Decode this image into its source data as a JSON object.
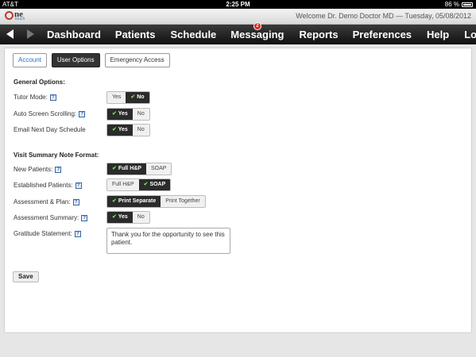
{
  "status_bar": {
    "carrier": "AT&T",
    "time": "2:25 PM",
    "battery": "86 %"
  },
  "header": {
    "logo_main": "ne",
    "logo_sub": "touch",
    "welcome": "Welcome Dr. Demo Doctor MD — Tuesday, 05/08/2012"
  },
  "nav": {
    "items": [
      {
        "label": "Dashboard"
      },
      {
        "label": "Patients"
      },
      {
        "label": "Schedule"
      },
      {
        "label": "Messaging",
        "badge": "2"
      },
      {
        "label": "Reports"
      },
      {
        "label": "Preferences"
      },
      {
        "label": "Help"
      },
      {
        "label": "Logout"
      }
    ]
  },
  "tabs": [
    {
      "label": "Account"
    },
    {
      "label": "User Options"
    },
    {
      "label": "Emergency Access"
    }
  ],
  "general": {
    "title": "General Options:",
    "tutor": {
      "label": "Tutor Mode:",
      "options": [
        "Yes",
        "No"
      ],
      "selected": "No"
    },
    "autoscroll": {
      "label": "Auto Screen Scrolling:",
      "options": [
        "Yes",
        "No"
      ],
      "selected": "Yes"
    },
    "email": {
      "label": "Email Next Day Schedule",
      "options": [
        "Yes",
        "No"
      ],
      "selected": "Yes"
    }
  },
  "visit": {
    "title": "Visit Summary Note Format:",
    "new_patients": {
      "label": "New Patients:",
      "options": [
        "Full H&P",
        "SOAP"
      ],
      "selected": "Full H&P"
    },
    "established": {
      "label": "Established Patients:",
      "options": [
        "Full H&P",
        "SOAP"
      ],
      "selected": "SOAP"
    },
    "assessment_plan": {
      "label": "Assessment & Plan:",
      "options": [
        "Print Separate",
        "Print Together"
      ],
      "selected": "Print Separate"
    },
    "assessment_summary": {
      "label": "Assessment Summary:",
      "options": [
        "Yes",
        "No"
      ],
      "selected": "Yes"
    },
    "gratitude": {
      "label": "Gratitude Statement:",
      "value": "Thank you for the opportunity to see this patient."
    }
  },
  "save_label": "Save",
  "help_glyph": "?"
}
